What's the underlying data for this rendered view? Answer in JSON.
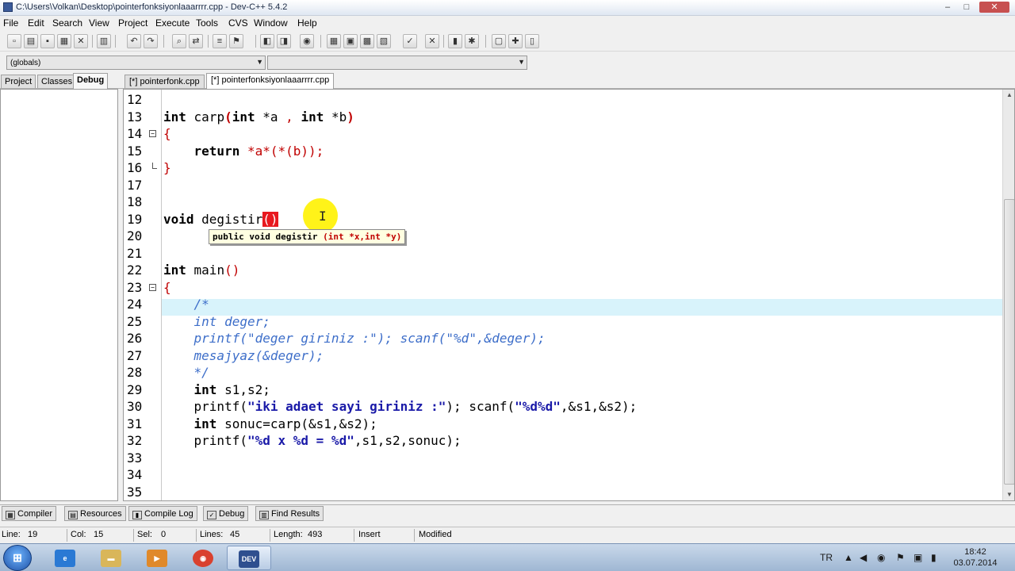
{
  "window": {
    "title": "C:\\Users\\Volkan\\Desktop\\pointerfonksiyonlaaarrrr.cpp - Dev-C++ 5.4.2",
    "min": "–",
    "max": "□",
    "close": "✕"
  },
  "menu": [
    "File",
    "Edit",
    "Search",
    "View",
    "Project",
    "Execute",
    "Tools",
    "CVS",
    "Window",
    "Help"
  ],
  "combos": {
    "scope": "(globals)",
    "member": ""
  },
  "left_tabs": [
    "Project",
    "Classes",
    "Debug"
  ],
  "file_tabs": [
    "[*] pointerfonk.cpp",
    "[*] pointerfonksiyonlaaarrrr.cpp"
  ],
  "editor": {
    "line_numbers": [
      "12",
      "13",
      "14",
      "15",
      "16",
      "17",
      "18",
      "19",
      "20",
      "21",
      "22",
      "23",
      "24",
      "25",
      "26",
      "27",
      "28",
      "29",
      "30",
      "31",
      "32",
      "33",
      "34",
      "35"
    ],
    "tooltip": {
      "signature": "public void degistir ",
      "params": "(int *x,int *y)"
    },
    "code": {
      "l13_kw1": "int",
      "l13_name": " carp",
      "l13_p1": "(",
      "l13_kw2": "int",
      "l13_a": " *a ",
      "l13_comma": ",",
      "l13_sp": " ",
      "l13_kw3": "int",
      "l13_b": " *b",
      "l13_p2": ")",
      "l14": "{",
      "l15_indent": "    ",
      "l15_kw": "return",
      "l15_rest": " *a*(*(b));",
      "l16": "}",
      "l19_kw": "void",
      "l19_name": " degistir",
      "l19_parens": "()",
      "l22_kw": "int",
      "l22_name": " main",
      "l22_parens": "()",
      "l23": "{",
      "l24": "    /*",
      "l25": "    int deger;",
      "l26": "    printf(\"deger giriniz :\"); scanf(\"%d\",&deger);",
      "l27": "    mesajyaz(&deger);",
      "l28": "    */",
      "l29_indent": "    ",
      "l29_kw": "int",
      "l29_rest": " s1,s2;",
      "l30_a": "    printf(",
      "l30_str": "\"iki adaet sayi giriniz :\"",
      "l30_b": "); scanf(",
      "l30_str2": "\"%d%d\"",
      "l30_c": ",&s1,&s2);",
      "l31_indent": "    ",
      "l31_kw": "int",
      "l31_rest": " sonuc=carp(&s1,&s2);",
      "l32_a": "    printf(",
      "l32_str": "\"%d x %d = %d\"",
      "l32_b": ",s1,s2,sonuc);"
    }
  },
  "bottom_tabs": [
    "Compiler",
    "Resources",
    "Compile Log",
    "Debug",
    "Find Results"
  ],
  "status": {
    "line_label": "Line:",
    "line": "19",
    "col_label": "Col:",
    "col": "15",
    "sel_label": "Sel:",
    "sel": "0",
    "lines_label": "Lines:",
    "lines": "45",
    "length_label": "Length:",
    "length": "493",
    "mode": "Insert",
    "modified": "Modified"
  },
  "taskbar": {
    "lang": "TR",
    "time": "18:42",
    "date": "03.07.2014",
    "devcpp_label": "DEV"
  }
}
